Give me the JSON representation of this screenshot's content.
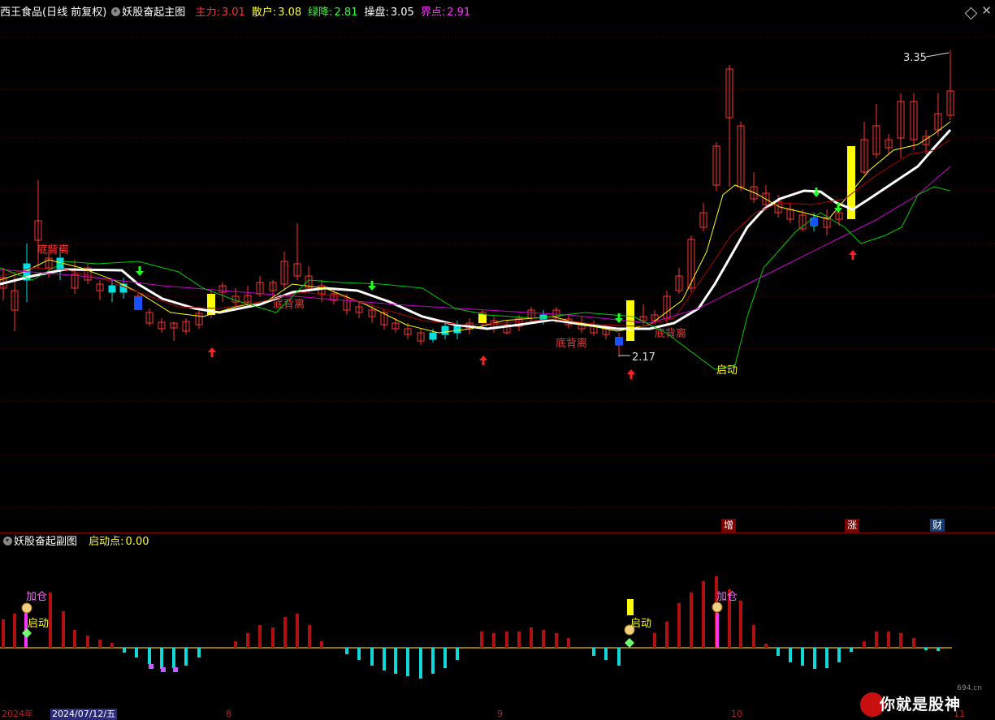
{
  "main_header": {
    "stock_title": "西王食品(日线 前复权)",
    "indicator_name": "妖股奋起主图",
    "items": [
      {
        "label": "主力:",
        "value": "3.01",
        "color": "#ff3333"
      },
      {
        "label": "散户:",
        "value": "3.08",
        "color": "#ffff33"
      },
      {
        "label": "绿降:",
        "value": "2.81",
        "color": "#33ff33"
      },
      {
        "label": "操盘:",
        "value": "3.05",
        "color": "#ffffff"
      },
      {
        "label": "界点:",
        "value": "2.91",
        "color": "#ff33ff"
      }
    ]
  },
  "sub_header": {
    "indicator_name": "妖股奋起副图",
    "label": "启动点:",
    "value": "0.00"
  },
  "annotations": {
    "max_price": "3.35",
    "min_price": "2.17",
    "divergence": "底背离",
    "start": "启动",
    "add_position": "加仓"
  },
  "tags": [
    "增",
    "涨",
    "财"
  ],
  "date_bar": {
    "year": "2024年",
    "selected": "2024/07/12/五",
    "m8": "8",
    "m9": "9",
    "m10": "10",
    "m11": "11"
  },
  "watermark": {
    "url": "694.cn",
    "text": "你就是股神"
  },
  "colors": {
    "up": "#ff3232",
    "down": "#00e0e0",
    "ma_white": "#ffffff",
    "ma_yellow": "#ffff00",
    "ma_darkred": "#b00000",
    "ma_magenta": "#cc00cc",
    "ma_green": "#00cc00"
  }
}
